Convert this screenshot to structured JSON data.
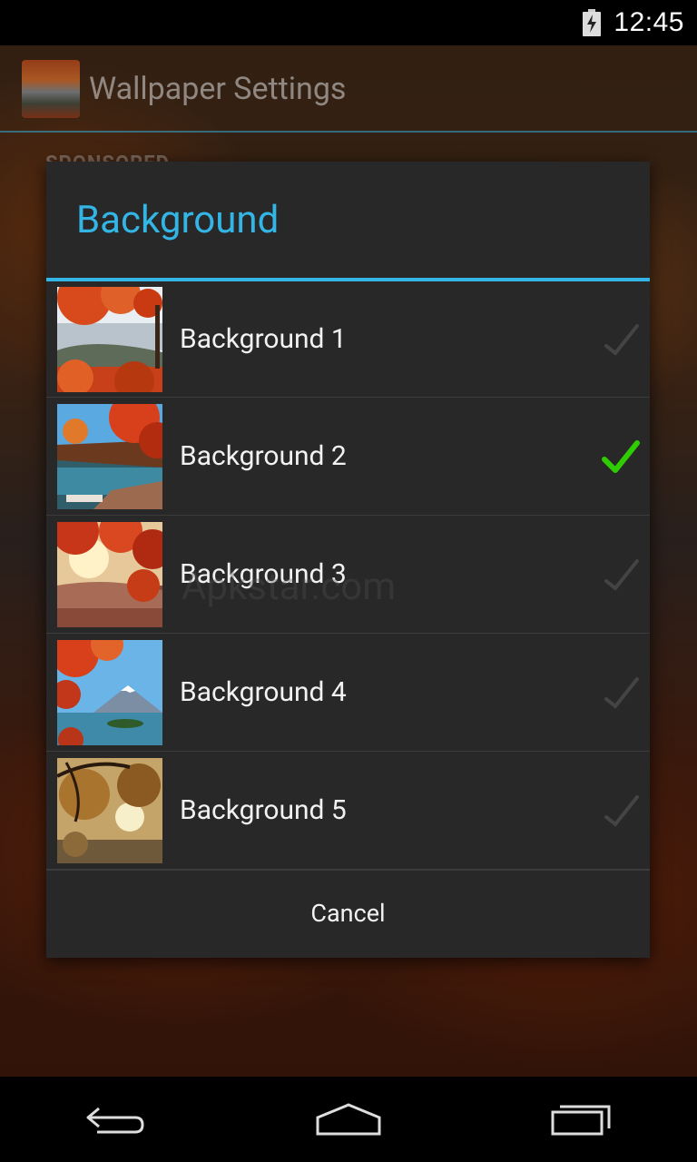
{
  "status_bar": {
    "time": "12:45",
    "battery_icon": "battery-charging-icon"
  },
  "app": {
    "title": "Wallpaper Settings",
    "sponsored_label": "SPONSORED"
  },
  "dialog": {
    "title": "Background",
    "items": [
      {
        "label": "Background 1",
        "selected": false
      },
      {
        "label": "Background 2",
        "selected": true
      },
      {
        "label": "Background 3",
        "selected": false
      },
      {
        "label": "Background 4",
        "selected": false
      },
      {
        "label": "Background 5",
        "selected": false
      }
    ],
    "cancel_label": "Cancel"
  },
  "watermark": "Apkstar.com",
  "colors": {
    "accent": "#33b5e5",
    "dialog_bg": "#282828",
    "check_selected": "#2ecc00"
  },
  "nav": {
    "back_icon": "back-icon",
    "home_icon": "home-icon",
    "recents_icon": "recents-icon"
  }
}
